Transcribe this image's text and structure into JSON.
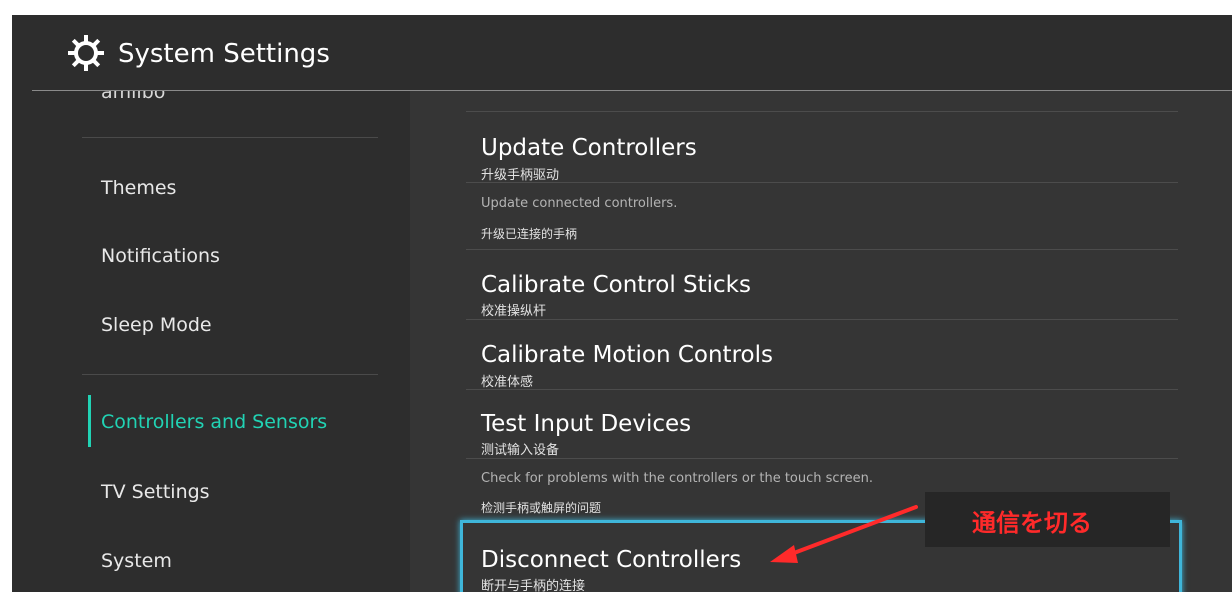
{
  "header": {
    "title": "System Settings",
    "icon": "gear-icon"
  },
  "sidebar": {
    "cut_item": "amiibo",
    "items": [
      {
        "label": "Themes"
      },
      {
        "label": "Notifications"
      },
      {
        "label": "Sleep Mode"
      },
      {
        "label": "Controllers and Sensors",
        "active": true
      },
      {
        "label": "TV Settings"
      },
      {
        "label": "System"
      }
    ],
    "accent_color": "#21d3b4"
  },
  "main": {
    "options": [
      {
        "title": "Update Controllers",
        "subtitle": "升级手柄驱动",
        "description": "Update connected controllers.",
        "description_sub": "升级已连接的手柄"
      },
      {
        "title": "Calibrate Control Sticks",
        "subtitle": "校准操纵杆"
      },
      {
        "title": "Calibrate Motion Controls",
        "subtitle": "校准体感"
      },
      {
        "title": "Test Input Devices",
        "subtitle": "测试输入设备",
        "description": "Check for problems with the controllers or the touch screen.",
        "description_sub": "检测手柄或触屏的问题"
      },
      {
        "title": "Disconnect Controllers",
        "subtitle": "断开与手柄的连接",
        "selected": true
      }
    ],
    "selection_color": "#3fb6da"
  },
  "annotation": {
    "text": "通信を切る",
    "color": "#ff2a2a",
    "arrow_icon": "red-arrow-icon"
  }
}
